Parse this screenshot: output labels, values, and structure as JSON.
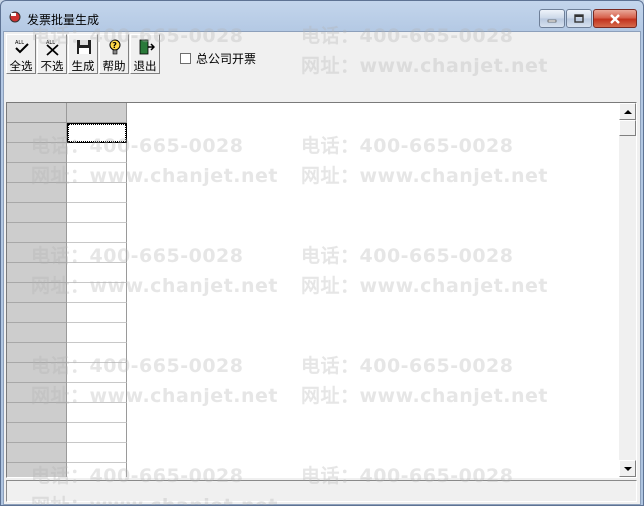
{
  "window": {
    "title": "发票批量生成"
  },
  "toolbar": {
    "buttons": [
      {
        "id": "select-all",
        "label": "全选",
        "icon": "select-all-icon"
      },
      {
        "id": "deselect",
        "label": "不选",
        "icon": "deselect-icon"
      },
      {
        "id": "generate",
        "label": "生成",
        "icon": "save-disk-icon"
      },
      {
        "id": "help",
        "label": "帮助",
        "icon": "help-bulb-icon"
      },
      {
        "id": "exit",
        "label": "退出",
        "icon": "exit-door-icon"
      }
    ]
  },
  "options": {
    "head_office_invoice": {
      "label": "总公司开票",
      "checked": false
    }
  },
  "grid": {
    "row_count": 18,
    "active_cell": {
      "row": 0,
      "col": 1
    }
  },
  "watermark": {
    "phone": "电话：400-665-0028",
    "site": "网址：www.chanjet.net"
  },
  "colors": {
    "accent_close": "#c2331e",
    "title_gradient": "#b4c9e4",
    "grid_header": "#cfcfcf"
  }
}
